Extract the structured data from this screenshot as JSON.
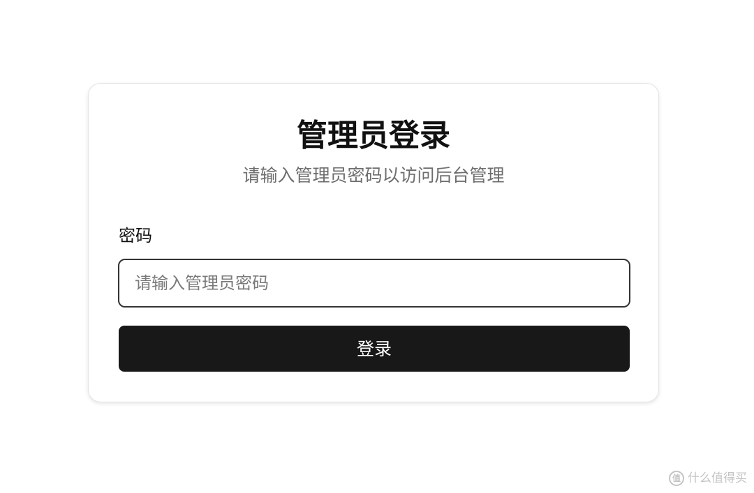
{
  "login": {
    "title": "管理员登录",
    "subtitle": "请输入管理员密码以访问后台管理",
    "password_label": "密码",
    "password_placeholder": "请输入管理员密码",
    "password_value": "",
    "submit_label": "登录"
  },
  "watermark": {
    "text": "什么值得买",
    "logo": "值"
  },
  "colors": {
    "button_background": "#181818",
    "button_text": "#ffffff",
    "input_border": "#333333",
    "subtitle_text": "#6e6e6e"
  }
}
